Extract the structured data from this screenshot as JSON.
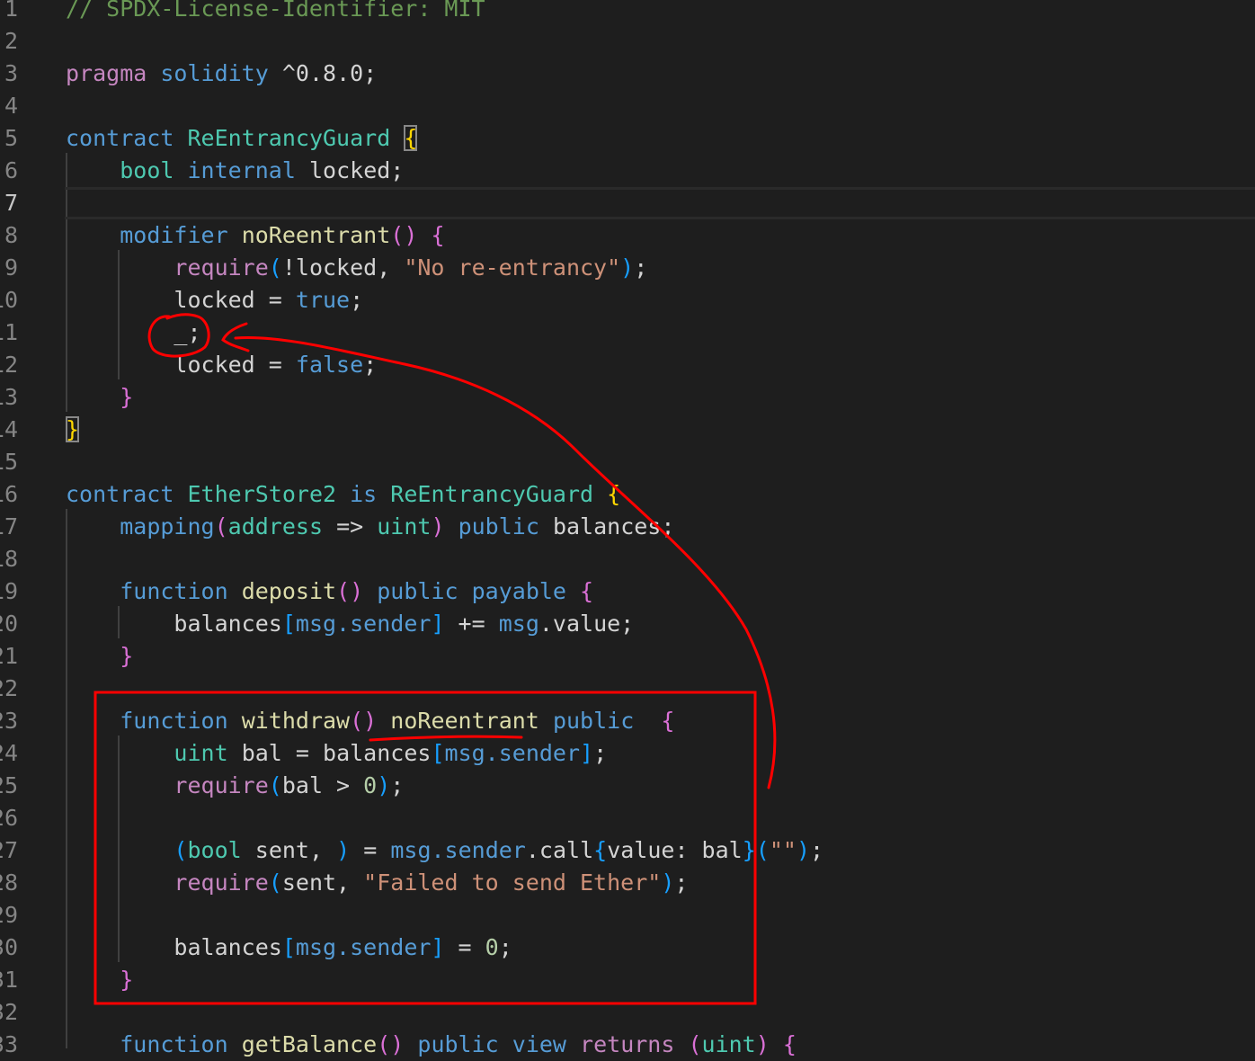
{
  "editor": {
    "language": "solidity",
    "current_line": 7,
    "lines": [
      {
        "n": "1"
      },
      {
        "n": "2"
      },
      {
        "n": "3"
      },
      {
        "n": "4"
      },
      {
        "n": "5"
      },
      {
        "n": "6"
      },
      {
        "n": "7"
      },
      {
        "n": "8"
      },
      {
        "n": "9"
      },
      {
        "n": "10"
      },
      {
        "n": "11"
      },
      {
        "n": "12"
      },
      {
        "n": "13"
      },
      {
        "n": "14"
      },
      {
        "n": "15"
      },
      {
        "n": "16"
      },
      {
        "n": "17"
      },
      {
        "n": "18"
      },
      {
        "n": "19"
      },
      {
        "n": "20"
      },
      {
        "n": "21"
      },
      {
        "n": "22"
      },
      {
        "n": "23"
      },
      {
        "n": "24"
      },
      {
        "n": "25"
      },
      {
        "n": "26"
      },
      {
        "n": "27"
      },
      {
        "n": "28"
      },
      {
        "n": "29"
      },
      {
        "n": "30"
      },
      {
        "n": "31"
      },
      {
        "n": "32"
      },
      {
        "n": "33"
      }
    ],
    "tokens": {
      "l1": "// SPDX-License-Identifier: MIT",
      "pragma": "pragma",
      "solidity": "solidity",
      "version": "^0.8.0;",
      "contract": "contract",
      "guard_name": "ReEntrancyGuard",
      "lbrace": "{",
      "rbrace": "}",
      "bool": "bool",
      "internal": "internal",
      "locked_decl": "locked;",
      "modifier": "modifier",
      "noReentrant": "noReentrant",
      "parens": "()",
      "require": "require",
      "lparen": "(",
      "rparen": ")",
      "not_locked": "!locked,",
      "no_reentrancy_str": "\"No re-entrancy\"",
      "semi": ";",
      "locked_eq": "locked =",
      "true": "true",
      "underscore": "_;",
      "false": "false",
      "store_name": "EtherStore2",
      "is": "is",
      "mapping": "mapping",
      "address": "address",
      "arrow": "=>",
      "uint": "uint",
      "public": "public",
      "balances_decl": "balances;",
      "function": "function",
      "deposit": "deposit",
      "payable": "payable",
      "balances": "balances",
      "lbracket": "[",
      "rbracket": "]",
      "msg_sender": "msg.sender",
      "plus_eq": "+=",
      "msg": "msg",
      "dot_value": ".value;",
      "withdraw": "withdraw",
      "bal_eq": "bal =",
      "bal_gt": "bal >",
      "zero": "0",
      "sent_comma": "sent,",
      "eq": "=",
      "dot_call": ".call",
      "value_colon": "value: bal",
      "empty_str": "\"\"",
      "sent_require": "sent,",
      "failed_str": "\"Failed to send Ether\"",
      "getBalance": "getBalance",
      "view": "view",
      "returns": "returns"
    }
  },
  "annotations": {
    "color": "#ff0000"
  },
  "colors": {
    "background": "#1e1e1e",
    "keyword": "#569cd6",
    "control": "#c586c0",
    "type": "#4ec9b0",
    "function": "#dcdcaa",
    "string": "#ce9178",
    "number": "#b5cea8",
    "comment": "#6a9955"
  }
}
